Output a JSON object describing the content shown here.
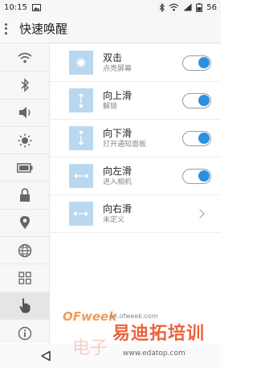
{
  "status_bar": {
    "time": "10:15",
    "battery": "56"
  },
  "header": {
    "title": "快速唤醒"
  },
  "sidebar": {
    "items": [
      {
        "icon": "wifi-icon"
      },
      {
        "icon": "bluetooth-icon"
      },
      {
        "icon": "volume-icon"
      },
      {
        "icon": "brightness-icon"
      },
      {
        "icon": "battery-icon"
      },
      {
        "icon": "lock-icon"
      },
      {
        "icon": "location-icon"
      },
      {
        "icon": "globe-icon"
      },
      {
        "icon": "grid-icon"
      },
      {
        "icon": "gesture-hand-icon",
        "active": true
      },
      {
        "icon": "info-icon"
      }
    ]
  },
  "gestures": [
    {
      "name": "双击",
      "desc": "点亮屏幕",
      "icon": "double-tap-icon",
      "enabled": true
    },
    {
      "name": "向上滑",
      "desc": "解锁",
      "icon": "swipe-up-icon",
      "enabled": true
    },
    {
      "name": "向下滑",
      "desc": "打开通知面板",
      "icon": "swipe-down-icon",
      "enabled": true
    },
    {
      "name": "向左滑",
      "desc": "进入相机",
      "icon": "swipe-left-icon",
      "enabled": true
    },
    {
      "name": "向右滑",
      "desc": "未定义",
      "icon": "swipe-right-icon",
      "enabled": null
    }
  ],
  "watermark": {
    "brand": "OFweek",
    "site": "ee.ofweek.com",
    "big_text": "易迪拓培训",
    "dian": "电子",
    "url": "www.edatop.com"
  },
  "colors": {
    "accent": "#2a90e0",
    "thumb_bg": "#b9d8f0"
  }
}
